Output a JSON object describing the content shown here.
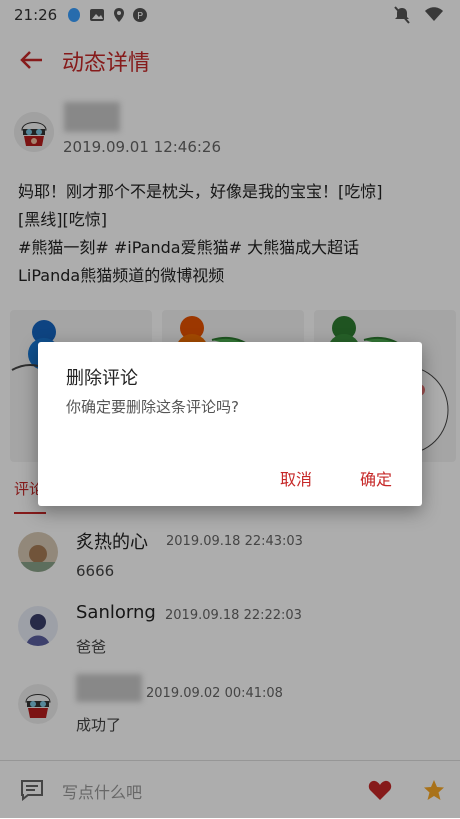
{
  "statusbar": {
    "time": "21:26"
  },
  "appbar": {
    "title": "动态详情"
  },
  "post": {
    "time": "2019.09.01 12:46:26",
    "content": "妈耶！刚才那个不是枕头，好像是我的宝宝！[吃惊]\n[黑线][吃惊]\n#熊猫一刻# #iPanda爱熊猫# 大熊猫成大超话\nLiPanda熊猫频道的微博视频"
  },
  "tabs": {
    "comments_label": "评论"
  },
  "comments": [
    {
      "name": "炙热的心",
      "time": "2019.09.18 22:43:03",
      "text": "6666"
    },
    {
      "name": "Sanlorng",
      "time": "2019.09.18 22:22:03",
      "text": "爸爸"
    },
    {
      "name": "",
      "time": "2019.09.02 00:41:08",
      "text": "成功了"
    }
  ],
  "bottombar": {
    "input_placeholder": "写点什么吧"
  },
  "dialog": {
    "title": "删除评论",
    "message": "你确定要删除这条评论吗?",
    "cancel_label": "取消",
    "confirm_label": "确定"
  },
  "colors": {
    "accent": "#c62828",
    "overlay": "rgba(0,0,0,0.32)"
  }
}
